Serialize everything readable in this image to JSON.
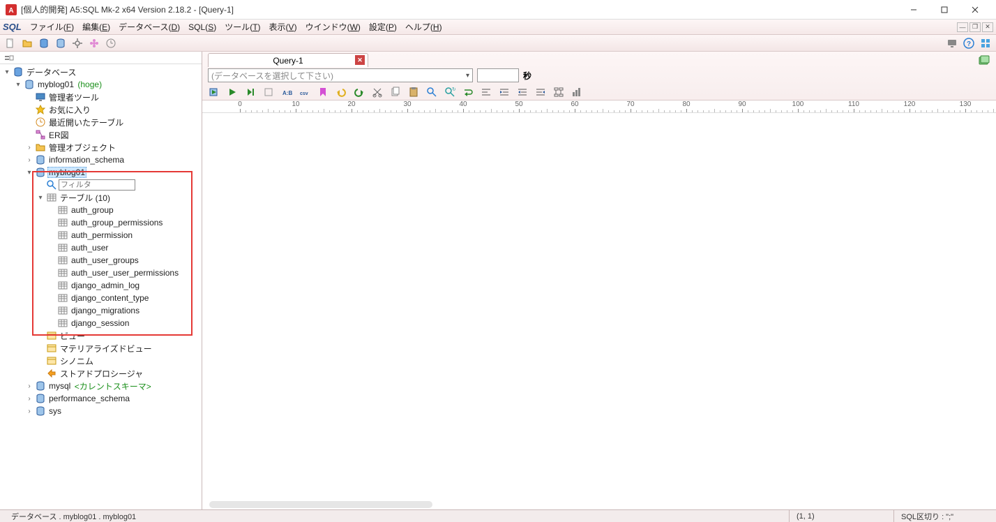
{
  "titlebar": {
    "title": "[個人的開発] A5:SQL Mk-2 x64 Version 2.18.2 - [Query-1]"
  },
  "menu": {
    "items": [
      {
        "label": "ファイル(",
        "u": "F",
        "tail": ")"
      },
      {
        "label": "編集(",
        "u": "E",
        "tail": ")"
      },
      {
        "label": "データベース(",
        "u": "D",
        "tail": ")"
      },
      {
        "label": "SQL(",
        "u": "S",
        "tail": ")"
      },
      {
        "label": "ツール(",
        "u": "T",
        "tail": ")"
      },
      {
        "label": "表示(",
        "u": "V",
        "tail": ")"
      },
      {
        "label": "ウインドウ(",
        "u": "W",
        "tail": ")"
      },
      {
        "label": "設定(",
        "u": "P",
        "tail": ")"
      },
      {
        "label": "ヘルプ(",
        "u": "H",
        "tail": ")"
      }
    ]
  },
  "sidebar": {
    "root": "データベース",
    "connection": {
      "name": "myblog01",
      "alias": "(hoge)"
    },
    "items": {
      "admin_tools": "管理者ツール",
      "favorites": "お気に入り",
      "recent_tables": "最近開いたテーブル",
      "er": "ER図",
      "mgmt_objects": "管理オブジェクト",
      "info_schema": "information_schema"
    },
    "selected_schema": "myblog01",
    "filter_placeholder": "フィルタ",
    "tables": {
      "label": "テーブル (10)",
      "list": [
        "auth_group",
        "auth_group_permissions",
        "auth_permission",
        "auth_user",
        "auth_user_groups",
        "auth_user_user_permissions",
        "django_admin_log",
        "django_content_type",
        "django_migrations",
        "django_session"
      ]
    },
    "after": {
      "views": "ビュー",
      "matviews": "マテリアライズドビュー",
      "synonyms": "シノニム",
      "procs": "ストアドプロシージャ"
    },
    "mysql": {
      "name": "mysql",
      "note": "<カレントスキーマ>"
    },
    "perf_schema": "performance_schema",
    "sys": "sys"
  },
  "content": {
    "tab": {
      "label": "Query-1"
    },
    "dbselect_placeholder": "(データベースを選択して下さい)",
    "sec_label": "秒",
    "ruler_ticks": [
      0,
      10,
      20,
      30,
      40,
      50,
      60,
      70,
      80,
      90,
      100,
      110,
      120,
      130
    ]
  },
  "status": {
    "path": "データベース . myblog01 . myblog01",
    "cursor": "(1, 1)",
    "sql_sep": "SQL区切り : \";\""
  }
}
